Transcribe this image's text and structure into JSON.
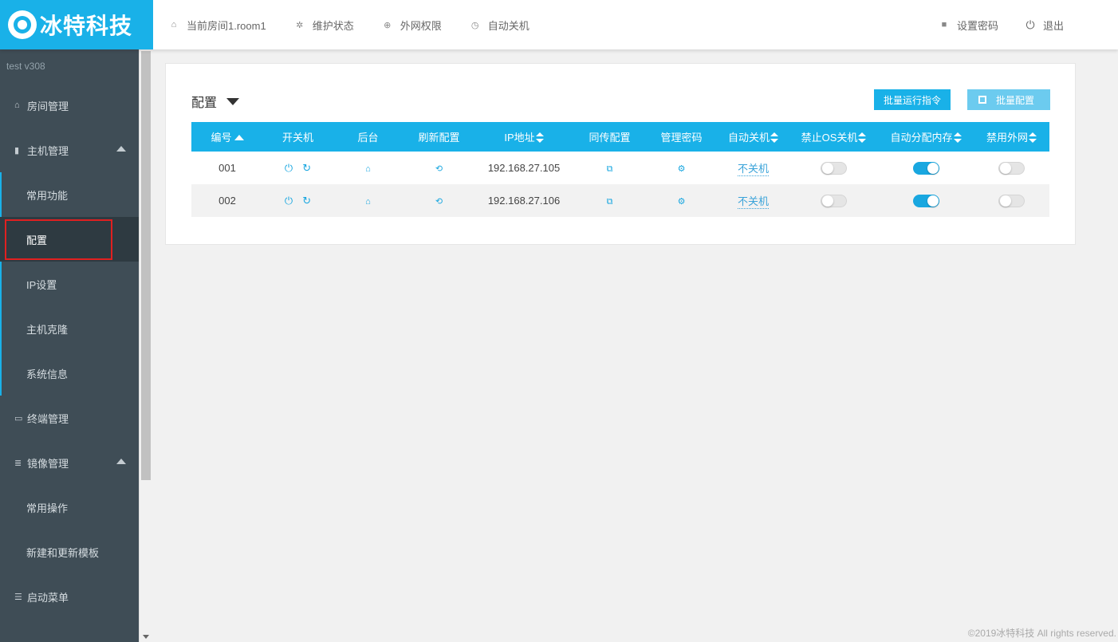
{
  "brand": {
    "name": "冰特科技",
    "color": "#19b1e8"
  },
  "nav_left": [
    {
      "icon": "home-icon",
      "label": "当前房间1.room1"
    },
    {
      "icon": "wrench-icon",
      "label": "维护状态"
    },
    {
      "icon": "globe-icon",
      "label": "外网权限"
    },
    {
      "icon": "clock-icon",
      "label": "自动关机"
    }
  ],
  "nav_right": [
    {
      "icon": "lock-icon",
      "label": "设置密码"
    },
    {
      "icon": "power-icon",
      "label": "退出"
    }
  ],
  "sidebar": {
    "version": "test  v308",
    "room_mgmt": "房间管理",
    "host_mgmt": "主机管理",
    "host_sub": [
      "常用功能",
      "配置",
      "IP设置",
      "主机克隆",
      "系统信息"
    ],
    "terminal_mgmt": "终端管理",
    "image_mgmt": "镜像管理",
    "image_sub": [
      "常用操作",
      "新建和更新模板"
    ],
    "boot_menu": "启动菜单"
  },
  "panel": {
    "title": "配置",
    "btn_batch_run": "批量运行指令",
    "btn_batch_config": "批量配置"
  },
  "table": {
    "headers": [
      "编号",
      "开关机",
      "后台",
      "刷新配置",
      "IP地址",
      "同传配置",
      "管理密码",
      "自动关机",
      "禁止OS关机",
      "自动分配内存",
      "禁用外网"
    ],
    "rows": [
      {
        "id": "001",
        "ip": "192.168.27.105",
        "auto_shutdown": "不关机",
        "forbid_os_shutdown": false,
        "auto_memory": true,
        "disable_internet": false
      },
      {
        "id": "002",
        "ip": "192.168.27.106",
        "auto_shutdown": "不关机",
        "forbid_os_shutdown": false,
        "auto_memory": true,
        "disable_internet": false
      }
    ]
  },
  "footer": "©2019冰特科技 All rights reserved."
}
